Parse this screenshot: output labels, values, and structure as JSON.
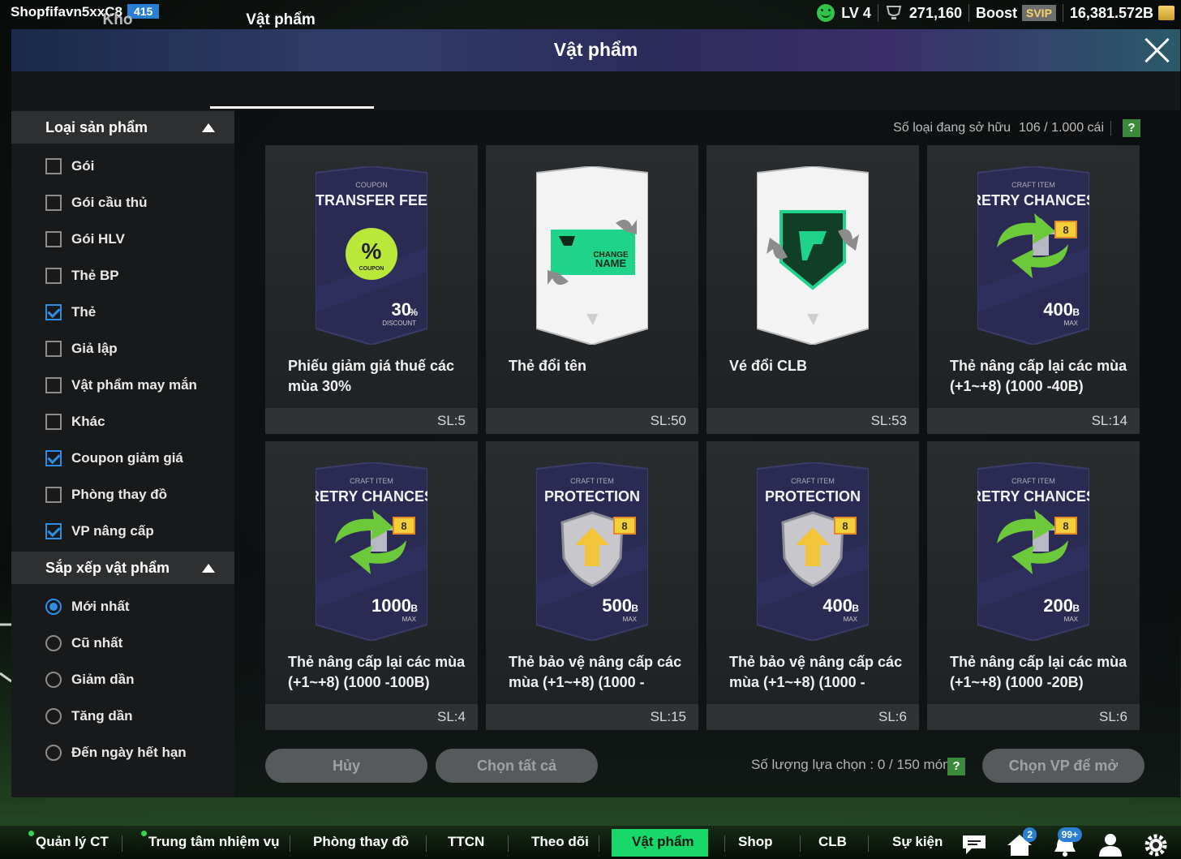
{
  "topbar": {
    "username": "Shopfifavn5xxC8",
    "user_level": "415",
    "level": "LV 4",
    "points": "271,160",
    "boost_label": "Boost",
    "svip_label": "SVIP",
    "balance": "16,381.572B"
  },
  "header": {
    "title": "Vật phẩm"
  },
  "tabs": [
    {
      "label": "Kho"
    },
    {
      "label": "Vật phẩm"
    }
  ],
  "active_tab": "Vật phẩm",
  "filters": {
    "product_title": "Loại sản phẩm",
    "product_types": [
      {
        "label": "Gói",
        "checked": false
      },
      {
        "label": "Gói cầu thủ",
        "checked": false
      },
      {
        "label": "Gói HLV",
        "checked": false
      },
      {
        "label": "Thẻ BP",
        "checked": false
      },
      {
        "label": "Thẻ",
        "checked": true
      },
      {
        "label": "Giả lập",
        "checked": false
      },
      {
        "label": "Vật phẩm may mắn",
        "checked": false
      },
      {
        "label": "Khác",
        "checked": false
      },
      {
        "label": "Coupon giảm giá",
        "checked": true
      },
      {
        "label": "Phòng thay đồ",
        "checked": false
      },
      {
        "label": "VP nâng cấp",
        "checked": true
      }
    ],
    "sort_title": "Sắp xếp vật phẩm",
    "sort_options": [
      {
        "label": "Mới nhất",
        "selected": true
      },
      {
        "label": "Cũ nhất",
        "selected": false
      },
      {
        "label": "Giảm dần",
        "selected": false
      },
      {
        "label": "Tăng dần",
        "selected": false
      },
      {
        "label": "Đến ngày hết hạn",
        "selected": false
      }
    ]
  },
  "owned": {
    "label": "Số loại đang sở hữu",
    "count": "106 / 1.000 cái",
    "help": "?"
  },
  "items": [
    {
      "name": "Phiếu giảm giá thuế các mùa 30%",
      "qty": "SL:5",
      "art": "coupon",
      "art_top": "COUPON",
      "art_title": "TRANSFER FEE",
      "art_badge": "%",
      "art_badge_sub": "COUPON",
      "art_value": "30",
      "art_unit": "%",
      "art_sub": "DISCOUNT"
    },
    {
      "name": "Thẻ đổi tên",
      "qty": "SL:50",
      "art": "change-name",
      "art_line1": "CHANGE",
      "art_line2": "NAME"
    },
    {
      "name": "Vé đổi CLB",
      "qty": "SL:53",
      "art": "change-club"
    },
    {
      "name": "Thẻ nâng cấp lại các mùa (+1~+8) (1000 -40B)",
      "qty": "SL:14",
      "art": "retry",
      "art_top": "CRAFT ITEM",
      "art_title": "RETRY CHANCES",
      "art_level": "8",
      "art_value": "400",
      "art_unit": "B",
      "art_sub": "MAX"
    },
    {
      "name": "Thẻ nâng cấp lại các mùa (+1~+8) (1000 -100B)",
      "qty": "SL:4",
      "art": "retry",
      "art_top": "CRAFT ITEM",
      "art_title": "RETRY CHANCES",
      "art_level": "8",
      "art_value": "1000",
      "art_unit": "B",
      "art_sub": "MAX"
    },
    {
      "name": "Thẻ bảo vệ nâng cấp các mùa (+1~+8) (1000 -",
      "qty": "SL:15",
      "art": "protection",
      "art_top": "CRAFT ITEM",
      "art_title": "PROTECTION",
      "art_level": "8",
      "art_value": "500",
      "art_unit": "B",
      "art_sub": "MAX"
    },
    {
      "name": "Thẻ bảo vệ nâng cấp các mùa (+1~+8) (1000 -",
      "qty": "SL:6",
      "art": "protection",
      "art_top": "CRAFT ITEM",
      "art_title": "PROTECTION",
      "art_level": "8",
      "art_value": "400",
      "art_unit": "B",
      "art_sub": "MAX"
    },
    {
      "name": "Thẻ nâng cấp lại các mùa (+1~+8) (1000 -20B)",
      "qty": "SL:6",
      "art": "retry",
      "art_top": "CRAFT ITEM",
      "art_title": "RETRY CHANCES",
      "art_level": "8",
      "art_value": "200",
      "art_unit": "B",
      "art_sub": "MAX"
    }
  ],
  "actions": {
    "cancel": "Hủy",
    "select_all": "Chọn tất cả",
    "selection_count": "Số lượng lựa chọn : 0 / 150 món",
    "help": "?",
    "open": "Chọn VP để mở"
  },
  "nav": [
    {
      "label": "Quản lý CT",
      "dot": true
    },
    {
      "label": "Trung tâm nhiệm vụ",
      "dot": true
    },
    {
      "label": "Phòng thay đồ"
    },
    {
      "label": "TTCN"
    },
    {
      "label": "Theo dõi"
    },
    {
      "label": "Vật phẩm",
      "active": true
    },
    {
      "label": "Shop"
    },
    {
      "label": "CLB"
    },
    {
      "label": "Sự kiện"
    }
  ],
  "nav_icons": [
    {
      "icon": "chat-icon"
    },
    {
      "icon": "home-icon",
      "badge": "2"
    },
    {
      "icon": "bell-icon",
      "badge": "99+"
    },
    {
      "icon": "profile-icon"
    },
    {
      "icon": "gear-icon"
    }
  ],
  "colors": {
    "accent": "#18d86a",
    "check": "#2f8de4",
    "card_bg": "#2a2d30"
  }
}
